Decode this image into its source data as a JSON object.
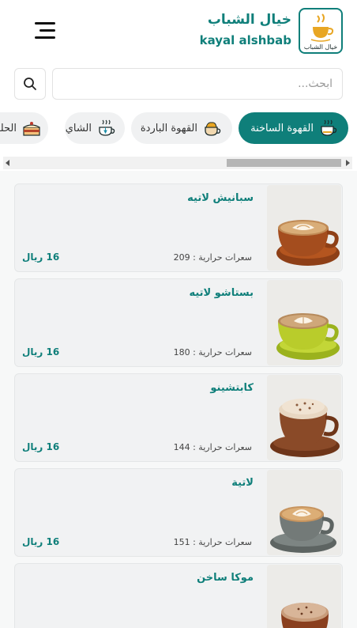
{
  "header": {
    "brand_ar": "خيال الشباب",
    "brand_en": "kayal alshbab",
    "logo_caption": "خيال الشباب",
    "accent_color": "#0f7f7a",
    "logo_cup_color": "#e8a623",
    "menu_icon": "hamburger-menu-icon"
  },
  "search": {
    "placeholder": "ابحث...",
    "value": "",
    "button_icon": "search-icon"
  },
  "categories": [
    {
      "label": "القهوة الساخنة",
      "icon": "hot-coffee-icon",
      "active": true
    },
    {
      "label": "القهوة الباردة",
      "icon": "iced-coffee-icon",
      "active": false
    },
    {
      "label": "الشاي",
      "icon": "tea-icon",
      "active": false
    },
    {
      "label": "الحلويات",
      "icon": "cake-icon",
      "active": false
    }
  ],
  "products": [
    {
      "name": "سبانيش لاتيه",
      "calories_label": "سعرات حرارية :",
      "calories": "209",
      "price": "16 ريال",
      "image": "latte-art-brown-cup",
      "cup_color": "#a44d1e"
    },
    {
      "name": "بستاشو لاتيه",
      "calories_label": "سعرات حرارية :",
      "calories": "180",
      "price": "16 ريال",
      "image": "latte-art-green-cup",
      "cup_color": "#b9cc2b"
    },
    {
      "name": "كابتشينو",
      "calories_label": "سعرات حرارية :",
      "calories": "144",
      "price": "16 ريال",
      "image": "cappuccino-brown-cup",
      "cup_color": "#8a4a28"
    },
    {
      "name": "لاتية",
      "calories_label": "سعرات حرارية :",
      "calories": "151",
      "price": "16 ريال",
      "image": "latte-grey-cup",
      "cup_color": "#737a78"
    },
    {
      "name": "موكا ساخن",
      "calories_label": "",
      "calories": "",
      "price": "",
      "image": "mocha-cup",
      "cup_color": "#8a3f1e"
    }
  ]
}
